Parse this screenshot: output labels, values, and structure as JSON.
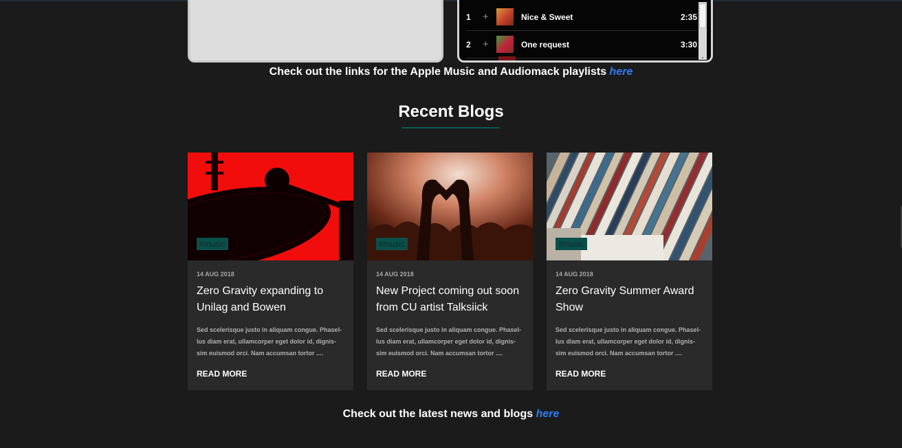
{
  "playlist": {
    "tracks": [
      {
        "num": "1",
        "title": "Nice & Sweet",
        "duration": "2:35"
      },
      {
        "num": "2",
        "title": "One request",
        "duration": "3:30"
      }
    ],
    "links_text": "Check out the links for the Apple Music and Audiomack playlists ",
    "links_anchor": "here"
  },
  "recent_blogs": {
    "heading": "Recent Blogs",
    "cards": [
      {
        "tag": "#music",
        "date": "14 AUG 2018",
        "title": "Zero Gravity expanding to Unilag and Bowen",
        "excerpt": "Sed scelerisque justo in aliquam congue. Phasel-lus diam erat, ullamcorper eget dolor id, dignis-sim euismod orci. Nam accumsan tortor ....",
        "read_more": "READ MORE"
      },
      {
        "tag": "#music",
        "date": "14 AUG 2018",
        "title": "New Project coming out soon from CU artist Talksiick",
        "excerpt": "Sed scelerisque justo in aliquam congue. Phasel-lus diam erat, ullamcorper eget dolor id, dignis-sim euismod orci. Nam accumsan tortor ....",
        "read_more": "READ MORE"
      },
      {
        "tag": "#music",
        "date": "14 AUG 2018",
        "title": "Zero Gravity Summer Award Show",
        "excerpt": "Sed scelerisque justo in aliquam congue. Phasel-lus diam erat, ullamcorper eget dolor id, dignis-sim euismod orci. Nam accumsan tortor ....",
        "read_more": "READ MORE"
      }
    ],
    "footer_text": "Check out the latest news and blogs ",
    "footer_anchor": "here"
  },
  "icons": {
    "add": "plus-icon",
    "scroll_down": "chevron-down-icon"
  },
  "colors": {
    "background": "#1b1b1b",
    "card": "#2a2a2a",
    "link": "#2f7cf5",
    "accent": "#0f5a55"
  }
}
